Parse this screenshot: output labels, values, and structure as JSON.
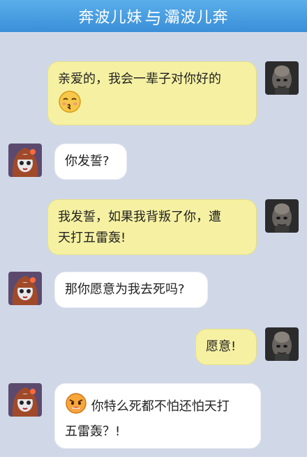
{
  "header": {
    "title_left": "奔波儿妹",
    "title_mid": "与",
    "title_right": "灞波儿奔"
  },
  "messages": [
    {
      "side": "right",
      "text": "亲爱的，我会一辈子对你好的",
      "emoji": "blush-kiss-face"
    },
    {
      "side": "left",
      "text": "你发誓?"
    },
    {
      "side": "right",
      "line1": "我发誓，如果我背叛了你，遭",
      "line2": "天打五雷轰!"
    },
    {
      "side": "left",
      "text": "那你愿意为我去死吗?"
    },
    {
      "side": "right",
      "text": "愿意!"
    },
    {
      "side": "left",
      "line1": "你特么死都不怕还怕天打",
      "line2": "五雷轰？!",
      "emoji": "angry-face"
    }
  ],
  "colors": {
    "header_top": "#5aaeea",
    "header_bottom": "#3a8fd8",
    "background": "#d0d8e8",
    "bubble_right": "#f6f1a2",
    "bubble_left": "#ffffff"
  }
}
